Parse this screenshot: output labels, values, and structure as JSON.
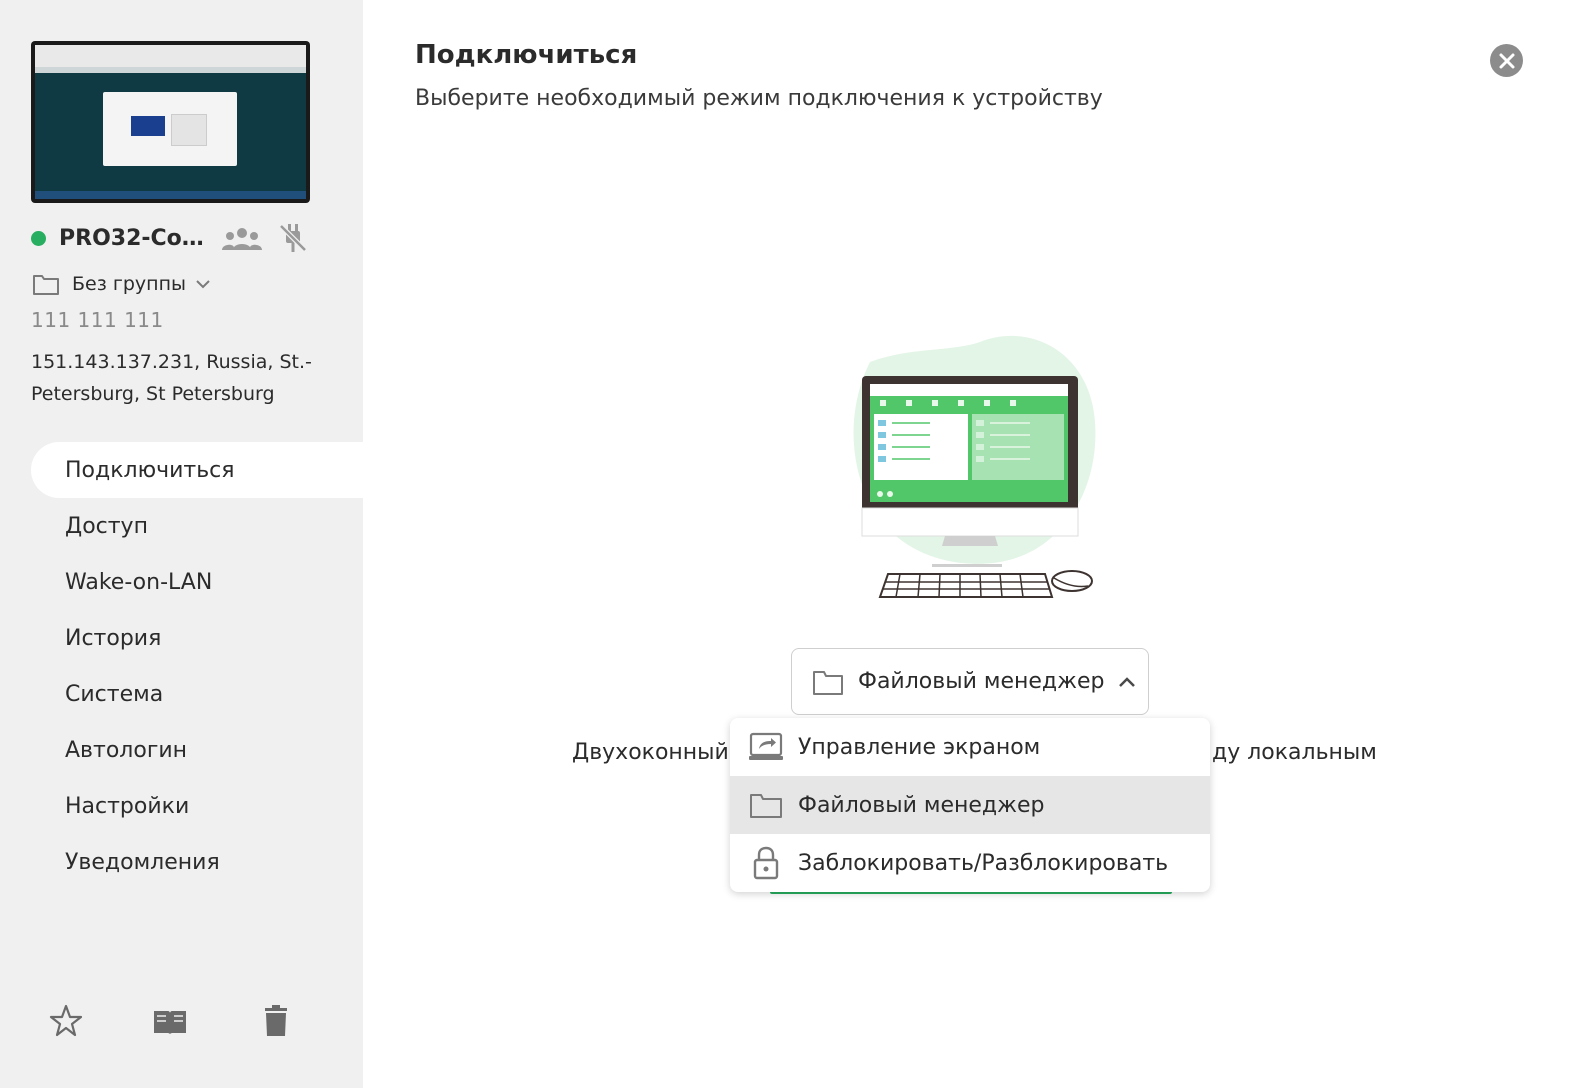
{
  "device": {
    "name": "PRO32-Con...",
    "group": "Без группы",
    "id": "111 111 111",
    "address": "151.143.137.231, Russia, St.-Petersburg, St Petersburg"
  },
  "nav": {
    "items": [
      {
        "label": "Подключиться"
      },
      {
        "label": "Доступ"
      },
      {
        "label": "Wake-on-LAN"
      },
      {
        "label": "История"
      },
      {
        "label": "Система"
      },
      {
        "label": "Автологин"
      },
      {
        "label": "Настройки"
      },
      {
        "label": "Уведомления"
      }
    ]
  },
  "main": {
    "title": "Подключиться",
    "subtitle": "Выберите необходимый режим подключения к устройству",
    "selected_mode": "Файловый менеджер",
    "desc_left": "Двухоконный",
    "desc_right": "ду локальным"
  },
  "dropdown": {
    "options": [
      {
        "label": "Управление экраном"
      },
      {
        "label": "Файловый менеджер"
      },
      {
        "label": "Заблокировать/Разблокировать"
      }
    ]
  },
  "colors": {
    "accent": "#27ae60",
    "sidebar_bg": "#f0f0f0",
    "online": "#27ae60"
  }
}
